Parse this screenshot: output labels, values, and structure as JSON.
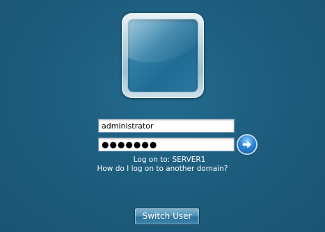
{
  "login": {
    "username_value": "administrator",
    "password_value": "●●●●●●●",
    "logon_to_text": "Log on to: SERVER1",
    "other_domain_link": "How do I log on to another domain?"
  },
  "switch_user_label": "Switch User",
  "icons": {
    "submit": "arrow-right-icon",
    "user_tile": "user-picture-tile"
  },
  "colors": {
    "background": "#1d5b7c",
    "button_blue": "#2f86d6",
    "text": "#ffffff"
  }
}
